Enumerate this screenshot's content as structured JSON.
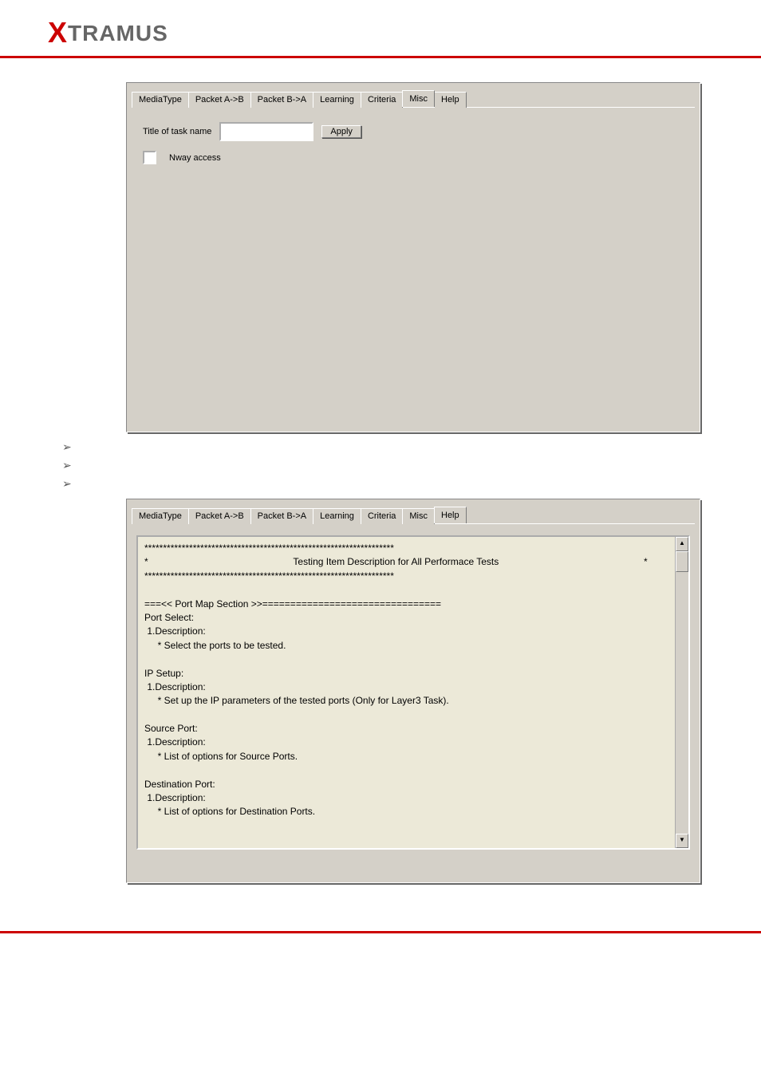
{
  "logo": {
    "prefix": "X",
    "rest": "TRAMUS"
  },
  "tabs": [
    "MediaType",
    "Packet A->B",
    "Packet B->A",
    "Learning",
    "Criteria",
    "Misc",
    "Help"
  ],
  "misc": {
    "title_label": "Title of task name",
    "apply": "Apply",
    "nway": "Nway access"
  },
  "help": {
    "stars": "*******************************************************************",
    "title": "Testing Item Description for All Performace Tests",
    "sec": "===<< Port Map Section >>================================",
    "portselect": "Port Select:",
    "desc": " 1.Description:",
    "portselect_d": "     * Select the ports to be tested.",
    "ipsetup": "IP Setup:",
    "ipsetup_d": "     * Set up the IP parameters of the tested ports (Only for Layer3 Task).",
    "srcport": "Source Port:",
    "srcport_d": "     * List of options for Source Ports.",
    "dstport": "Destination Port:",
    "dstport_d": "     * List of options for Destination Ports."
  }
}
